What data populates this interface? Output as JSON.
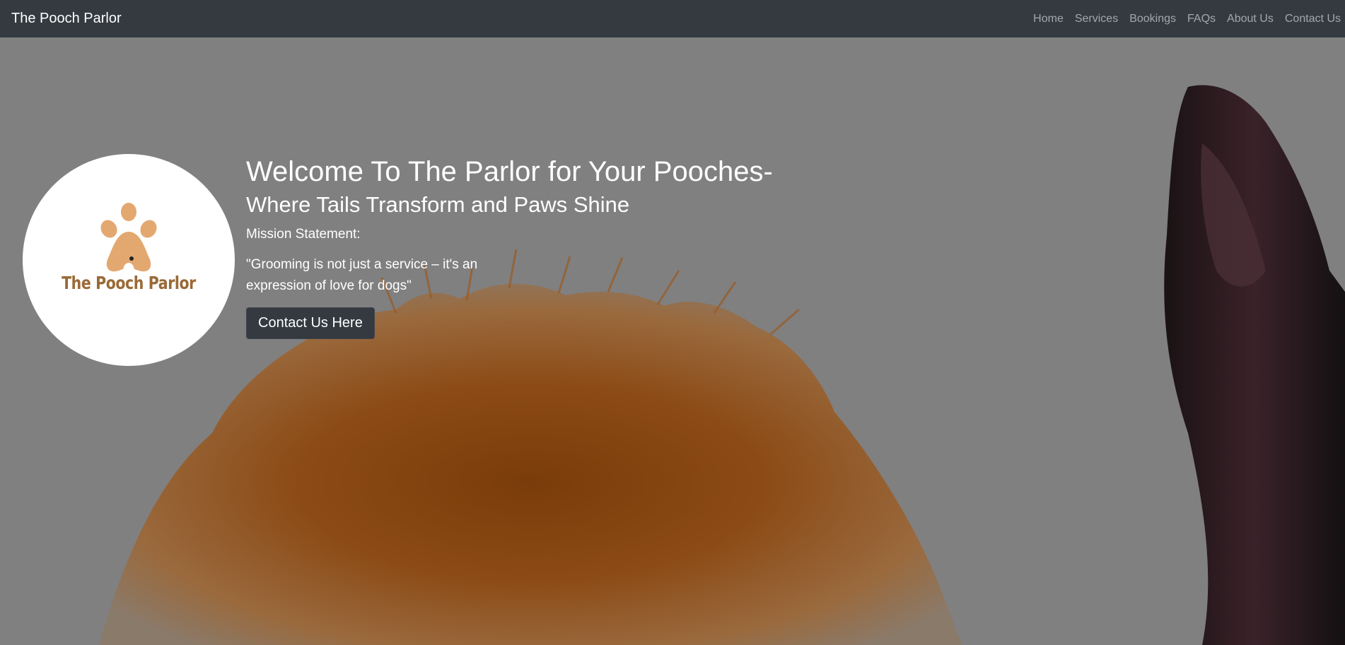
{
  "navbar": {
    "brand": "The Pooch Parlor",
    "links": [
      "Home",
      "Services",
      "Bookings",
      "FAQs",
      "About Us",
      "Contact Us"
    ]
  },
  "hero": {
    "logo_text": "The Pooch Parlor",
    "title": "Welcome To The Parlor for Your Pooches-",
    "subtitle": "Where Tails Transform and Paws Shine",
    "mission_label": "Mission Statement:",
    "mission_quote": "\"Grooming is not just a service – it's an expression of love for dogs\"",
    "cta_label": "Contact Us Here"
  },
  "colors": {
    "navbar_bg": "#343a40",
    "overlay": "#808080",
    "logo_brand": "#9a6a36",
    "paw": "#e3a870"
  }
}
